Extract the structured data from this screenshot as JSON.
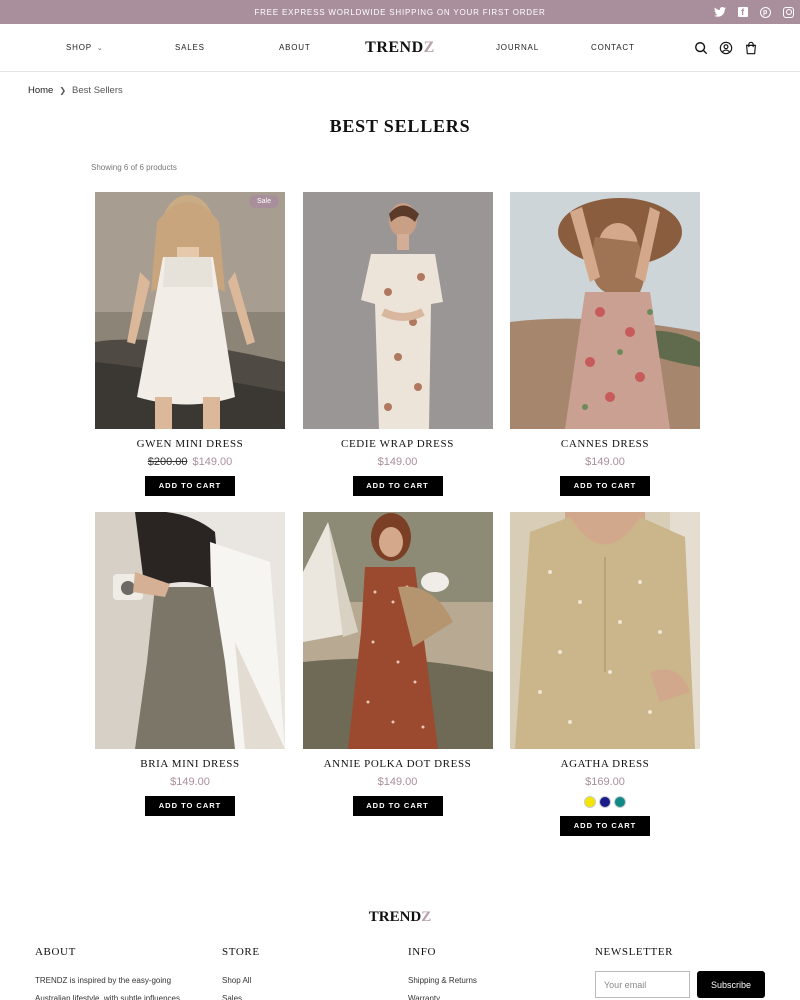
{
  "announcement": "FREE EXPRESS WORLDWIDE SHIPPING ON YOUR FIRST ORDER",
  "social": [
    "twitter-icon",
    "facebook-icon",
    "pinterest-icon",
    "instagram-icon"
  ],
  "nav": {
    "shop": "SHOP",
    "sales": "SALES",
    "about": "ABOUT",
    "journal": "JOURNAL",
    "contact": "CONTACT",
    "logo_main": "TREND",
    "logo_accent": "Z"
  },
  "breadcrumb": {
    "home": "Home",
    "current": "Best Sellers"
  },
  "page_title": "BEST SELLERS",
  "product_count": "Showing 6 of 6 products",
  "add_to_cart": "ADD TO CART",
  "products": [
    {
      "name": "GWEN MINI DRESS",
      "old_price": "$200.00",
      "price": "$149.00",
      "badge": "Sale"
    },
    {
      "name": "CEDIE WRAP DRESS",
      "price": "$149.00"
    },
    {
      "name": "CANNES DRESS",
      "price": "$149.00"
    },
    {
      "name": "BRIA MINI DRESS",
      "price": "$149.00"
    },
    {
      "name": "ANNIE POLKA DOT DRESS",
      "price": "$149.00"
    },
    {
      "name": "AGATHA DRESS",
      "price": "$169.00",
      "swatches": [
        "#f2e600",
        "#1a1a8c",
        "#0f8a86"
      ]
    }
  ],
  "colors": {
    "accent": "#a98e9c",
    "button": "#000000"
  },
  "footer": {
    "about_title": "ABOUT",
    "about_text_1": "TRENDZ is inspired by the easy-going",
    "about_text_2": "Australian lifestyle, with subtle influences",
    "store_title": "STORE",
    "store_links": [
      "Shop All",
      "Sales"
    ],
    "info_title": "INFO",
    "info_links": [
      "Shipping & Returns",
      "Warranty"
    ],
    "newsletter_title": "NEWSLETTER",
    "email_placeholder": "Your email",
    "subscribe": "Subscribe"
  }
}
